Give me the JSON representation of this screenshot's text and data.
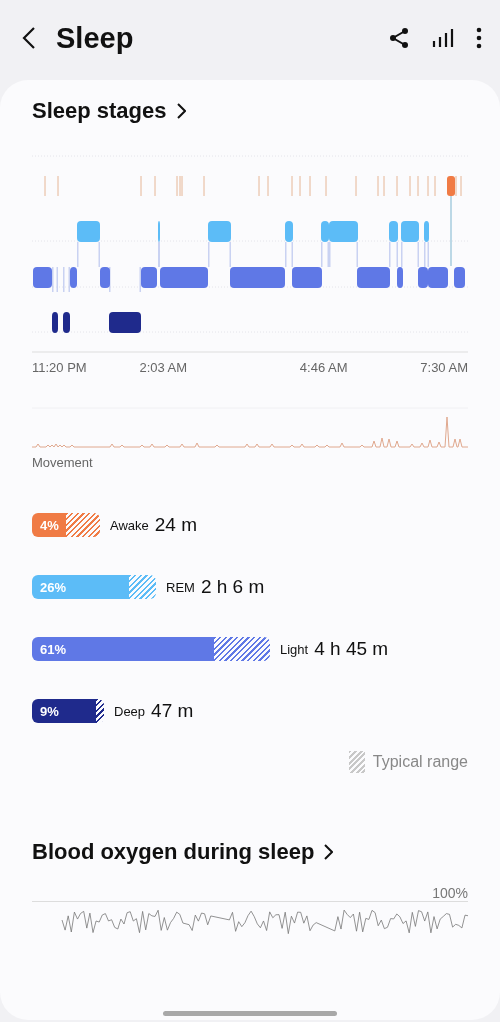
{
  "header": {
    "title": "Sleep"
  },
  "sleep_stages": {
    "title": "Sleep stages",
    "axis_labels": [
      "11:20 PM",
      "2:03 AM",
      "4:46 AM",
      "7:30 AM"
    ],
    "movement_label": "Movement",
    "stages": [
      {
        "percent": "4%",
        "name": "Awake",
        "duration": "24 m",
        "color": "#f07b45"
      },
      {
        "percent": "26%",
        "name": "REM",
        "duration": "2 h 6 m",
        "color": "#5cbcf7"
      },
      {
        "percent": "61%",
        "name": "Light",
        "duration": "4 h 45 m",
        "color": "#5f78e6"
      },
      {
        "percent": "9%",
        "name": "Deep",
        "duration": "47 m",
        "color": "#1f2a8c"
      }
    ],
    "legend": "Typical range"
  },
  "blood_oxygen": {
    "title": "Blood oxygen during sleep",
    "scale_label": "100%"
  }
}
